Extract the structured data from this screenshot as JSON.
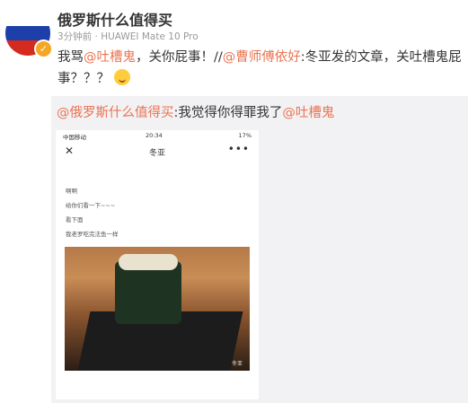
{
  "post": {
    "username": "俄罗斯什么值得买",
    "time_ago": "3分钟前",
    "via": "HUAWEI Mate 10 Pro",
    "text_a": "我骂",
    "mention_a": "@吐槽鬼",
    "text_b": "，关你屁事！//",
    "mention_b": "@曹师傅依好",
    "text_c": ":冬亚发的文章，关吐槽鬼屁事？？？"
  },
  "repost": {
    "mention_a": "@俄罗斯什么值得买",
    "text_a": ":我觉得你得罪我了",
    "mention_b": "@吐槽鬼"
  },
  "screenshot": {
    "carrier": "中国移动",
    "time": "20:34",
    "battery": "17%",
    "nav_title": "冬亚",
    "close": "✕",
    "more": "•••",
    "lines": [
      "啊啊",
      "给你们看一下~~~",
      "看下面",
      "我老罗吃完法鱼一样"
    ],
    "watermark": "冬亚"
  },
  "colors": {
    "mention": "#eb7350",
    "repost_bg": "#f2f2f5"
  }
}
